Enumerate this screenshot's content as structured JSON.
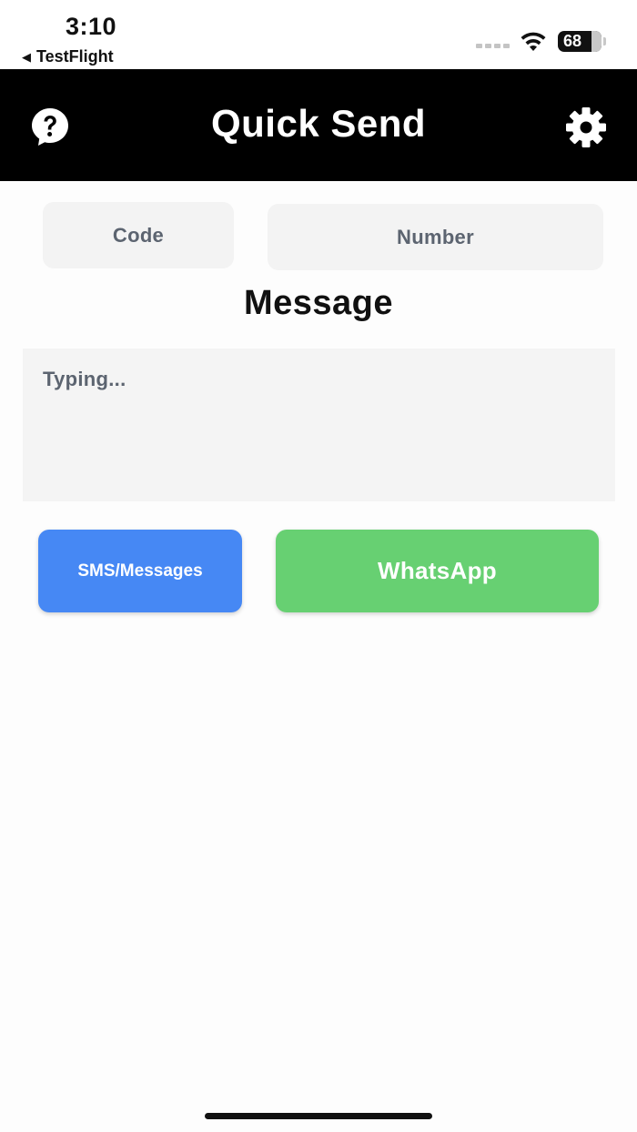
{
  "status_bar": {
    "time": "3:10",
    "back_app": "TestFlight",
    "back_arrow": "◀",
    "battery_level": "68"
  },
  "header": {
    "title": "Quick Send",
    "left_icon": "help-icon",
    "right_icon": "gear-icon",
    "background": "#000000"
  },
  "form": {
    "code_placeholder": "Code",
    "number_placeholder": "Number",
    "message_label": "Message",
    "message_placeholder": "Typing..."
  },
  "actions": {
    "sms_label": "SMS/Messages",
    "sms_color": "#4688f4",
    "whatsapp_label": "WhatsApp",
    "whatsapp_color": "#67d072"
  }
}
